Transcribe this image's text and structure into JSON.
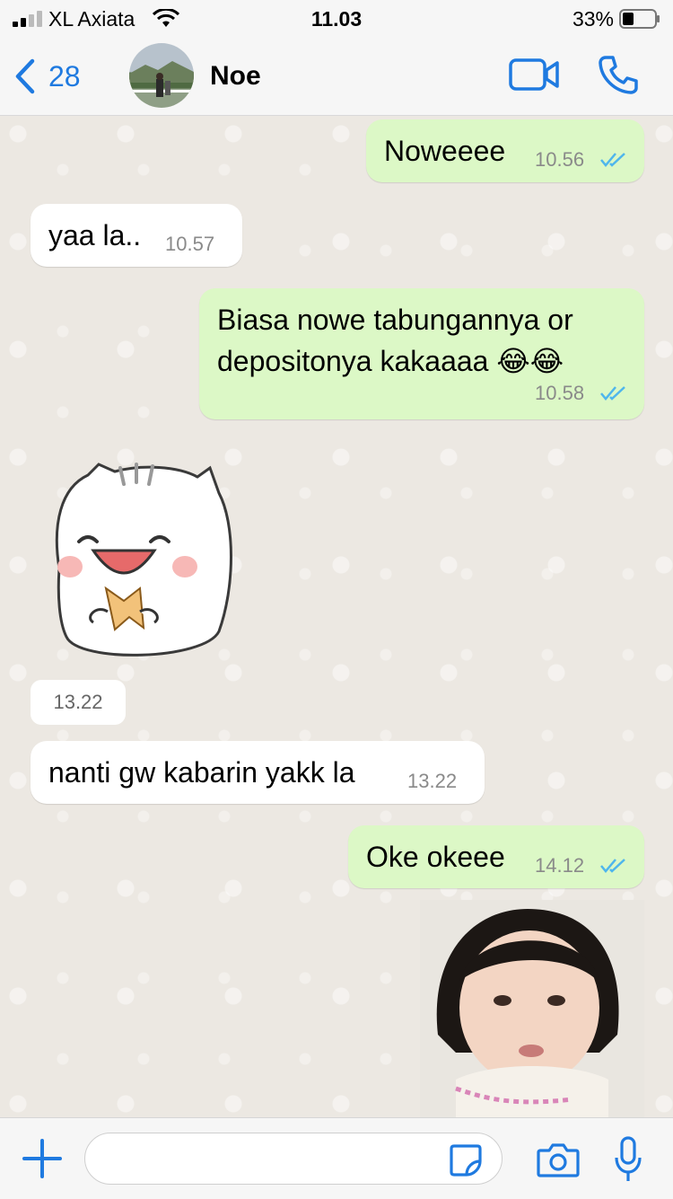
{
  "status_bar": {
    "carrier": "XL Axiata",
    "time": "11.03",
    "battery": "33%"
  },
  "header": {
    "back_count": "28",
    "contact_name": "Noe"
  },
  "messages": [
    {
      "direction": "out",
      "text": "Noweeee",
      "time": "10.56"
    },
    {
      "direction": "in",
      "text": "yaa la..",
      "time": "10.57"
    },
    {
      "direction": "out",
      "text_line1": "Biasa nowe tabungannya or",
      "text_line2": "depositonya kakaaaa 😂😂",
      "time": "10.58"
    },
    {
      "direction": "in",
      "type": "sticker",
      "time": "13.22"
    },
    {
      "direction": "in",
      "text": "nanti gw kabarin yakk la",
      "time": "13.22"
    },
    {
      "direction": "out",
      "text": "Oke okeee",
      "time": "14.12"
    },
    {
      "direction": "out",
      "type": "image"
    }
  ],
  "input": {
    "placeholder": ""
  },
  "colors": {
    "accent": "#1f7ae0",
    "outgoing_bubble": "#dcf8c6",
    "incoming_bubble": "#ffffff",
    "read_ticks": "#4fb6ec"
  },
  "icons": [
    "signal-icon",
    "wifi-icon",
    "battery-icon",
    "back-chevron-icon",
    "video-call-icon",
    "phone-icon",
    "plus-icon",
    "sticker-icon",
    "camera-icon",
    "microphone-icon"
  ]
}
